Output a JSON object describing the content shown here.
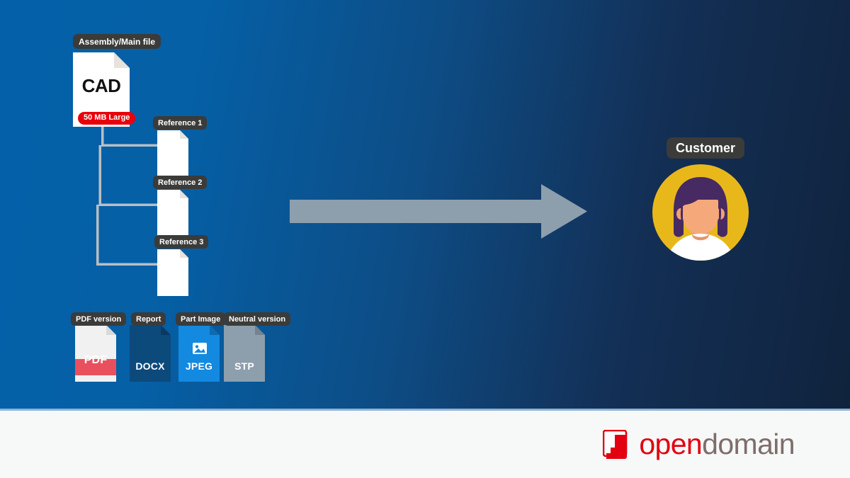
{
  "diagram": {
    "title_chips": {
      "assembly": "Assembly/Main file",
      "customer": "Customer"
    },
    "main_file": {
      "label": "Assembly/Main file",
      "name": "CAD",
      "size_badge": "50 MB Large"
    },
    "references": [
      {
        "label": "Reference 1"
      },
      {
        "label": "Reference 2"
      },
      {
        "label": "Reference 3"
      }
    ],
    "derived_files": [
      {
        "label": "PDF version",
        "name": "PDF",
        "color": "#f1f1f1",
        "band": "#e9505e",
        "text_color": "#ffffff"
      },
      {
        "label": "Report",
        "name": "DOCX",
        "color": "#0c4a7c",
        "band": "",
        "text_color": "#ffffff"
      },
      {
        "label": "Part Image",
        "name": "JPEG",
        "color": "#1489e0",
        "band": "",
        "text_color": "#ffffff"
      },
      {
        "label": "Neutral version",
        "name": "STP",
        "color": "#8d9fad",
        "band": "",
        "text_color": "#ffffff"
      }
    ],
    "recipient": {
      "label": "Customer"
    },
    "flow_arrow": {
      "direction": "right"
    }
  },
  "footer": {
    "logo": {
      "name_primary": "open",
      "name_secondary": "domain"
    }
  },
  "colors": {
    "background_start": "#0460a8",
    "background_end": "#10233d",
    "chip_background": "#3b3b39",
    "badge_red": "#e8030c",
    "arrow_gray": "#8d9fad",
    "avatar_circle": "#e8b81b",
    "logo_red": "#e3000f",
    "logo_gray": "#7d6e6a",
    "footer_background": "#f7f8f8"
  }
}
